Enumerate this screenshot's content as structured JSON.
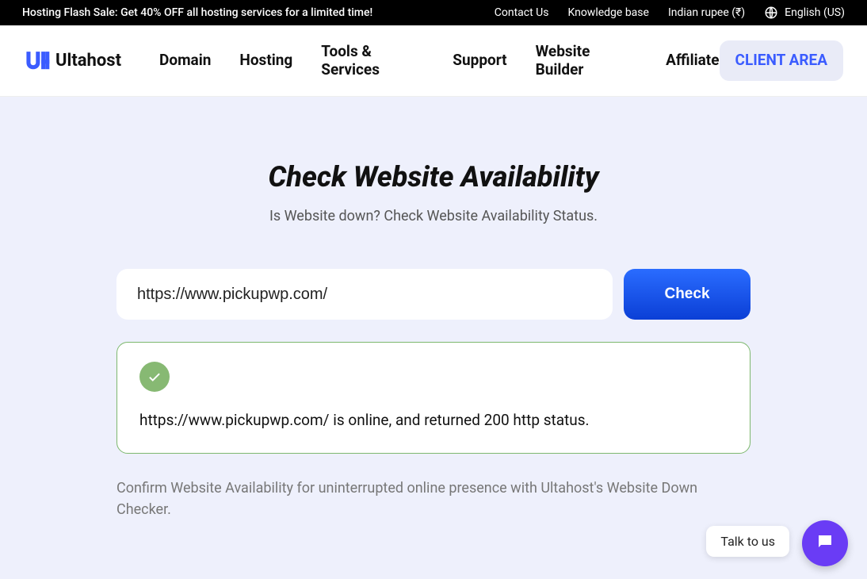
{
  "topbar": {
    "sale": "Hosting Flash Sale: Get 40% OFF all hosting services for a limited time!",
    "contact": "Contact Us",
    "kb": "Knowledge base",
    "currency": "Indian rupee (₹)",
    "language": "English (US)"
  },
  "nav": {
    "logo_text": "Ultahost",
    "items": [
      "Domain",
      "Hosting",
      "Tools & Services",
      "Support",
      "Website Builder",
      "Affiliate"
    ],
    "client_area": "CLIENT AREA"
  },
  "hero": {
    "title": "Check Website Availability",
    "subtitle": "Is Website down? Check Website Availability Status."
  },
  "form": {
    "url_value": "https://www.pickupwp.com/",
    "check_label": "Check"
  },
  "result": {
    "message": "https://www.pickupwp.com/ is online, and returned 200 http status."
  },
  "footer_note": "Confirm Website Availability for uninterrupted online presence with Ultahost's Website Down Checker.",
  "chat": {
    "label": "Talk to us"
  }
}
